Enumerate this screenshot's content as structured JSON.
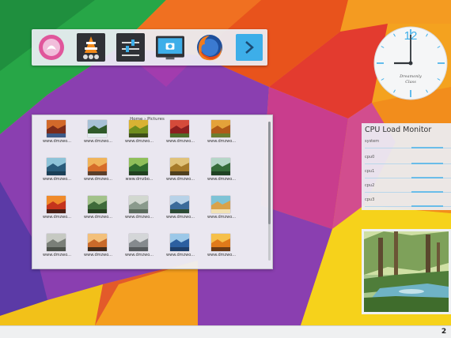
{
  "launcher": {
    "apps": [
      {
        "name": "pink-app-icon"
      },
      {
        "name": "vlc-icon"
      },
      {
        "name": "system-settings-icon"
      },
      {
        "name": "screenshot-app-icon"
      },
      {
        "name": "firefox-icon"
      },
      {
        "name": "launcher-arrow-icon"
      }
    ]
  },
  "clock": {
    "numeral_12": "12",
    "name": "Dreamonly\nClass",
    "time": "12:45"
  },
  "folder": {
    "path": "Home › Pictures",
    "items": [
      {
        "label": "www.dmzwo...",
        "theme": "red-water"
      },
      {
        "label": "www.dmzwo...",
        "theme": "waterfall"
      },
      {
        "label": "www.dmzwo...",
        "theme": "leaves"
      },
      {
        "label": "www.dmzwo...",
        "theme": "red-field"
      },
      {
        "label": "www.dmzwo...",
        "theme": "autumn"
      },
      {
        "label": "www.dmzwo...",
        "theme": "blue-lake"
      },
      {
        "label": "www.dmzwo...",
        "theme": "sunset-hills"
      },
      {
        "label": "www.dmzbo...",
        "theme": "forest"
      },
      {
        "label": "www.dmzwo...",
        "theme": "golden-forest"
      },
      {
        "label": "www.dmzwo...",
        "theme": "green-falls"
      },
      {
        "label": "www.dmzwo...",
        "theme": "red-sunset"
      },
      {
        "label": "www.dmzwo...",
        "theme": "rainforest"
      },
      {
        "label": "www.dmzwo...",
        "theme": "mist"
      },
      {
        "label": "www.dmzwo...",
        "theme": "mountain-lake"
      },
      {
        "label": "www.dmzwo...",
        "theme": "beach"
      },
      {
        "label": "www.dmzwo...",
        "theme": "grey-trees"
      },
      {
        "label": "www.dmzwo...",
        "theme": "dusk"
      },
      {
        "label": "www.dmzwo...",
        "theme": "grey-wood"
      },
      {
        "label": "www.dmzwo...",
        "theme": "blue-water"
      },
      {
        "label": "www.dmzwo...",
        "theme": "orange-sky"
      }
    ]
  },
  "cpu_monitor": {
    "title": "CPU Load Monitor",
    "rows": [
      {
        "label": "system"
      },
      {
        "label": "cpu0"
      },
      {
        "label": "cpu1"
      },
      {
        "label": "cpu2"
      },
      {
        "label": "cpu3"
      }
    ]
  },
  "panel": {
    "pager_label": "2"
  }
}
